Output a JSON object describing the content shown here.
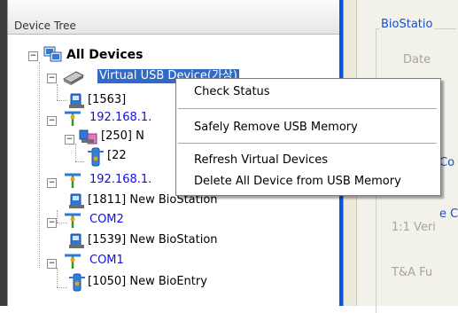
{
  "tree_header": {
    "title": "Device Tree"
  },
  "tree": {
    "root": {
      "label": "All Devices",
      "expander": "−"
    },
    "virtual_usb": {
      "label": "Virtual USB Device(가상)",
      "expander": "−"
    },
    "virtual_usb_child": {
      "label": "[1563]"
    },
    "net1": {
      "label": "192.168.1.",
      "expander": "−"
    },
    "net1_child": {
      "label": "[250] N",
      "expander": "−"
    },
    "net1_grandchild": {
      "label": "[22"
    },
    "net2": {
      "label": "192.168.1.",
      "expander": "−"
    },
    "net2_child": {
      "label": "[1811] New BioStation"
    },
    "com2": {
      "label": "COM2",
      "expander": "−"
    },
    "com2_child": {
      "label": "[1539] New BioStation"
    },
    "com1": {
      "label": "COM1",
      "expander": "−"
    },
    "com1_child": {
      "label": "[1050] New BioEntry"
    }
  },
  "context_menu": {
    "items": [
      {
        "label": "Check Status"
      },
      {
        "label": "Safely Remove USB Memory"
      },
      {
        "label": "Refresh Virtual Devices"
      },
      {
        "label": "Delete All Device from USB Memory"
      }
    ]
  },
  "right_pane": {
    "title": "BioStatio",
    "date_label": "Date",
    "frag_co": "Co",
    "frag_ec": "e C",
    "verify_label": "1:1 Veri",
    "ta_label": "T&A Fu"
  },
  "colors": {
    "selection": "#3169c6",
    "link_blue": "#1010e0",
    "splitter": "#0a55d9"
  }
}
